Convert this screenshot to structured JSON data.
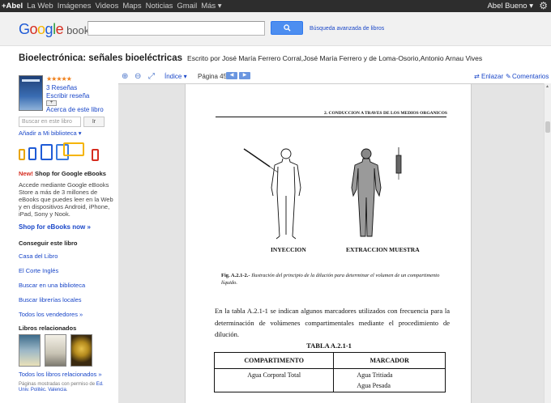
{
  "gbar": {
    "items": [
      "+Abel",
      "La Web",
      "Imágenes",
      "Videos",
      "Maps",
      "Noticias",
      "Gmail",
      "Más ▾"
    ],
    "user": "Abel Bueno ▾"
  },
  "header": {
    "logo_google": "Google",
    "logo_books": "books",
    "search_value": "",
    "search_button": "Q",
    "advanced_search": "Búsqueda avanzada de libros"
  },
  "book": {
    "title": "Bioelectrónica: señales bioeléctricas",
    "authors": "Escrito por José María Ferrero Corral,José María Ferrero y de Loma-Osorio,Antonio Arnau Vives",
    "stars": "★★★★★",
    "reviews": "3 Reseñas",
    "write_review": "Escribir reseña",
    "about": "Acerca de este libro",
    "search_inbook_placeholder": "Buscar en este libro",
    "search_inbook_button": "Ir",
    "add_library": "Añadir a Mi biblioteca ▾"
  },
  "promo": {
    "new_label": "New!",
    "title": " Shop for Google eBooks",
    "text": "Accede mediante Google eBooks Store a más de 3 millones de eBooks que puedes leer en la Web y en dispositivos Android, iPhone, iPad, Sony y Nook.",
    "shop_link": "Shop for eBooks now »"
  },
  "get_book": {
    "title": "Conseguir este libro",
    "links": [
      "Casa del Libro",
      "El Corte Inglés",
      "Buscar en una biblioteca",
      "Buscar librerías locales",
      "Todos los vendedores »"
    ]
  },
  "related": {
    "title": "Libros relacionados",
    "all_link": "Todos los libros relacionados »"
  },
  "footer": {
    "prefix": "Páginas mostradas con permiso de ",
    "link": "Ed. Univ. Politéc. Valencia",
    "suffix": "."
  },
  "toolbar": {
    "indice": "Índice ▾",
    "page_label": "Página 45",
    "prev": "◀",
    "next": "▶",
    "link_label": "Enlazar",
    "comments_label": "Comentarios"
  },
  "page": {
    "chapter_header": "2. CONDUCCION A TRAVES DE LOS MEDIOS ORGANICOS",
    "label_left": "INYECCION",
    "label_right": "EXTRACCION  MUESTRA",
    "caption_bold": "Fig. A.2.1-2.-",
    "caption_text": " Ilustración del principio de la dilución para determinar el volumen de un compartimento líquido.",
    "body_text": "En la tabla A.2.1-1 se indican algunos marcadores utilizados con frecuencia para la determinación de volúmenes compartimentales mediante el procedimiento de dilución.",
    "table_title": "TABLA A.2.1-1",
    "table_headers": [
      "COMPARTIMENTO",
      "MARCADOR"
    ],
    "table_row1_left": "Agua Corporal Total",
    "table_row1_right_1": "Agua Tritiada",
    "table_row1_right_2": "Agua Pesada"
  }
}
